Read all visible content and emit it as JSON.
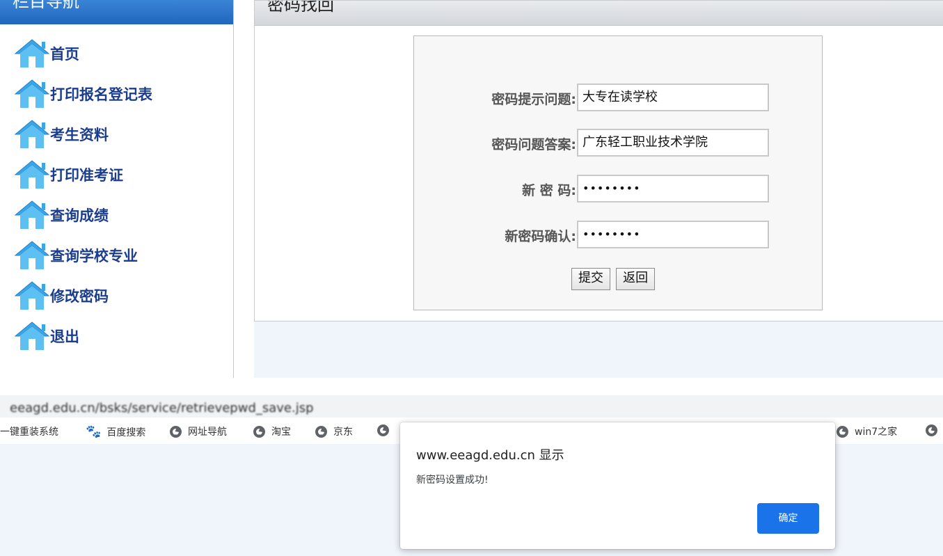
{
  "sidebar": {
    "header": "栏目导航",
    "items": [
      {
        "label": "首页"
      },
      {
        "label": "打印报名登记表"
      },
      {
        "label": "考生资料"
      },
      {
        "label": "打印准考证"
      },
      {
        "label": "查询成绩"
      },
      {
        "label": "查询学校专业"
      },
      {
        "label": "修改密码"
      },
      {
        "label": "退出"
      }
    ]
  },
  "panel": {
    "title": "密码找回",
    "form": {
      "question_label": "密码提示问题:",
      "question_value": "大专在读学校",
      "answer_label": "密码问题答案:",
      "answer_value": "广东轻工职业技术学院",
      "newpw_label": "新 密 码:",
      "newpw_value": "••••••••",
      "confirm_label": "新密码确认:",
      "confirm_value": "••••••••",
      "submit_label": "提交",
      "back_label": "返回"
    }
  },
  "browser": {
    "url": "eeagd.edu.cn/bsks/service/retrievepwd_save.jsp",
    "bookmarks": [
      {
        "label": "一键重装系统",
        "icon": "none"
      },
      {
        "label": "百度搜索",
        "icon": "baidu-paw-icon"
      },
      {
        "label": "网址导航",
        "icon": "globe-icon"
      },
      {
        "label": "淘宝",
        "icon": "globe-icon"
      },
      {
        "label": "京东",
        "icon": "globe-icon"
      },
      {
        "label": "win7之家",
        "icon": "globe-icon"
      }
    ]
  },
  "dialog": {
    "title": "www.eeagd.edu.cn 显示",
    "message": "新密码设置成功!",
    "ok_label": "确定"
  },
  "colors": {
    "sidebar_header": "#2b76cc",
    "nav_text": "#1b3d8f",
    "page_bg": "#f0f5fb",
    "primary_button": "#1a73e8"
  }
}
